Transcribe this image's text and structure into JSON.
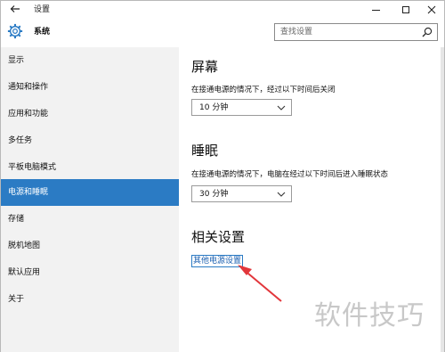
{
  "window": {
    "title": "设置",
    "section": "系统",
    "controls": [
      "minimize-icon",
      "maximize-icon",
      "close-icon"
    ]
  },
  "search": {
    "placeholder": "查找设置"
  },
  "sidebar": {
    "items": [
      {
        "label": "显示",
        "active": false
      },
      {
        "label": "通知和操作",
        "active": false
      },
      {
        "label": "应用和功能",
        "active": false
      },
      {
        "label": "多任务",
        "active": false
      },
      {
        "label": "平板电脑模式",
        "active": false
      },
      {
        "label": "电源和睡眠",
        "active": true
      },
      {
        "label": "存储",
        "active": false
      },
      {
        "label": "脱机地图",
        "active": false
      },
      {
        "label": "默认应用",
        "active": false
      },
      {
        "label": "关于",
        "active": false
      }
    ]
  },
  "main": {
    "screen": {
      "title": "屏幕",
      "desc": "在接通电源的情况下，经过以下时间后关闭",
      "value": "10 分钟"
    },
    "sleep": {
      "title": "睡眠",
      "desc": "在接通电源的情况下，电脑在经过以下时间后进入睡眠状态",
      "value": "30 分钟"
    },
    "related": {
      "title": "相关设置",
      "link": "其他电源设置"
    }
  },
  "watermark": "软件技巧",
  "colors": {
    "accent": "#2b7bc4",
    "link": "#1a5fb0",
    "sidebar_bg": "#f2f2f2",
    "annotation_arrow": "#e2363b"
  }
}
